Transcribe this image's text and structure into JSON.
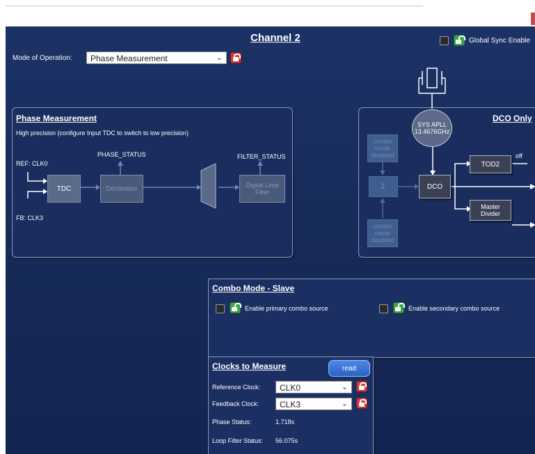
{
  "header": {
    "title": "Channel 2",
    "global_sync_label": "Global Sync Enable"
  },
  "mode": {
    "label": "Mode of Operation:",
    "value": "Phase Measurement"
  },
  "phase_panel": {
    "title": "Phase Measurement",
    "description": "High precision (configure Input TDC to switch to low precision)",
    "ref_label": "REF: CLK0",
    "fb_label": "FB: CLK3",
    "tdc": "TDC",
    "decimator": "Decimator",
    "phase_status": "PHASE_STATUS",
    "filter_status": "FILTER_STATUS",
    "loop_filter": "Digital Loop Filter"
  },
  "dco_panel": {
    "title": "DCO Only",
    "sys_apll_line1": "SYS APLL",
    "sys_apll_line2": "13.4676GHz",
    "combo_top": "combo mode disabled",
    "combo_bottom": "combo mode disabled",
    "sum": "Σ",
    "dco": "DCO",
    "tod2": "TOD2",
    "off": "off",
    "master_divider": "Master Divider"
  },
  "combo_panel": {
    "title": "Combo Mode - Slave",
    "primary_label": "Enable primary combo source",
    "secondary_label": "Enable secondary combo source"
  },
  "clocks_panel": {
    "title": "Clocks to Measure",
    "read_label": "read",
    "reference_label": "Reference Clock:",
    "reference_value": "CLK0",
    "feedback_label": "Feedback Clock:",
    "feedback_value": "CLK3",
    "phase_status_label": "Phase Status:",
    "phase_status_value": "1.718s",
    "loop_filter_label": "Loop Filter Status:",
    "loop_filter_value": "56.075s"
  },
  "colors": {
    "background": "#172b58",
    "lock_red": "#d33b3b",
    "unlock_green": "#3aa64a",
    "read_button": "#3a74d8"
  },
  "icons": [
    "lock-icon",
    "unlock-icon",
    "chevron-down-icon",
    "checkbox-icon"
  ]
}
